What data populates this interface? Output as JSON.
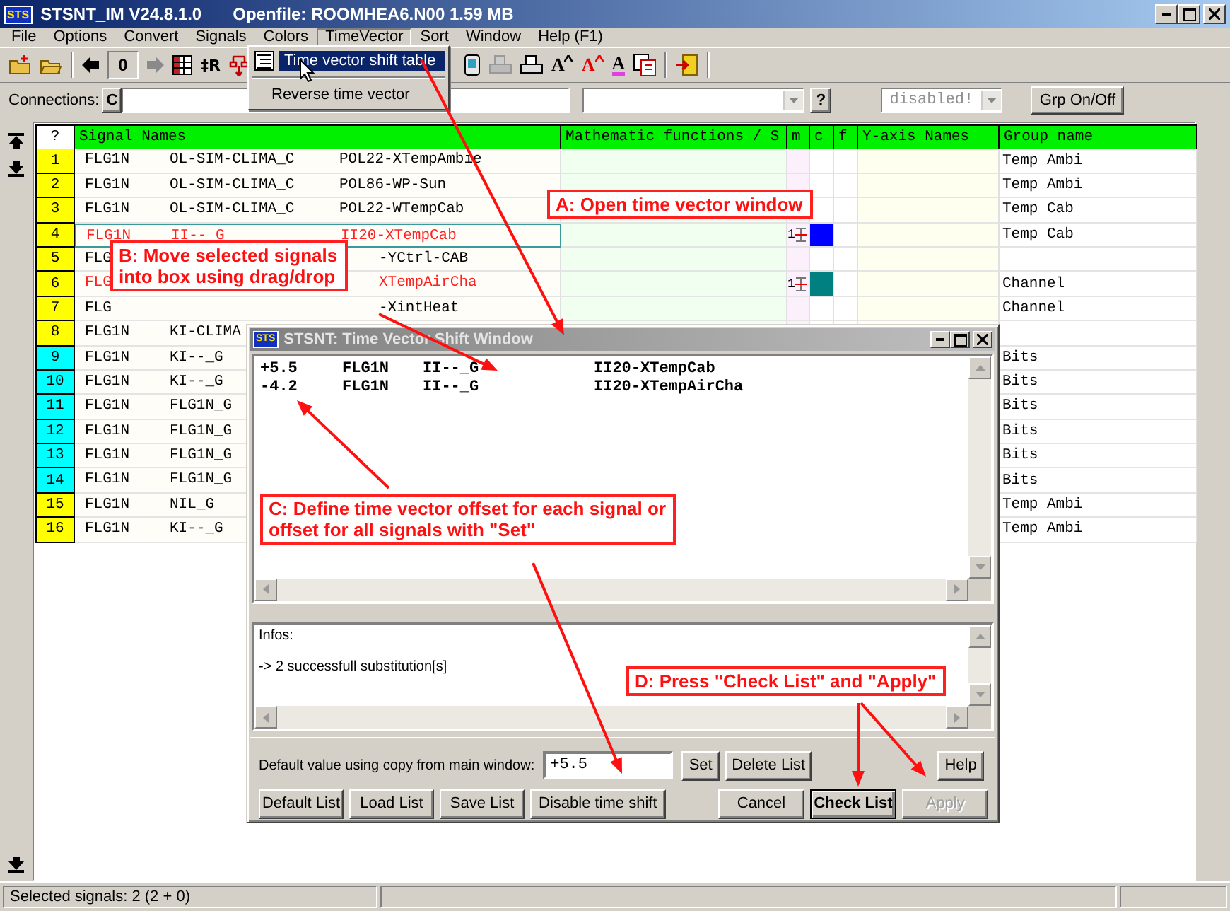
{
  "window": {
    "icon": "STS",
    "title": "STSNT_IM V24.8.1.0",
    "file": "Openfile: ROOMHEA6.N00  1.59 MB"
  },
  "menu": [
    {
      "label": "File",
      "selected": false
    },
    {
      "label": "Options",
      "selected": false
    },
    {
      "label": "Convert",
      "selected": false
    },
    {
      "label": "Signals",
      "selected": false
    },
    {
      "label": "Colors",
      "selected": false
    },
    {
      "label": "TimeVector",
      "selected": true
    },
    {
      "label": "Sort",
      "selected": false
    },
    {
      "label": "Window",
      "selected": false
    },
    {
      "label": "Help (F1)",
      "selected": false
    }
  ],
  "dropdown": [
    {
      "label": "Time vector shift table",
      "selected": true
    },
    {
      "label": "Reverse time vector",
      "selected": false
    }
  ],
  "toolbar": {
    "counter": "0",
    "glyphs": [
      {
        "kind": "plain",
        "text": "‡R"
      },
      {
        "kind": "grow",
        "text": "A"
      },
      {
        "kind": "grow-red",
        "text": "A"
      },
      {
        "kind": "colors",
        "text": "A"
      }
    ]
  },
  "connections": {
    "label": "Connections:",
    "button": "C",
    "help": "?",
    "state": "disabled!",
    "group_button": "Grp On/Off"
  },
  "table": {
    "columns": [
      "?",
      "Signal Names",
      "Mathematic functions / S",
      "m",
      "c",
      "f",
      "Y-axis Names",
      "Group name"
    ],
    "rows": [
      {
        "number": "1",
        "color": "#ffff00",
        "signal": {
          "col_1": "FLG1N",
          "col_2": "OL-SIM-CLIMA_C",
          "col_3": "POL22-XTempAmbie"
        },
        "selected": false,
        "focused": false,
        "group": "Temp Ambi"
      },
      {
        "number": "2",
        "color": "#ffff00",
        "signal": {
          "col_1": "FLG1N",
          "col_2": "OL-SIM-CLIMA_C",
          "col_3": "POL86-WP-Sun"
        },
        "selected": false,
        "focused": false,
        "group": "Temp Ambi"
      },
      {
        "number": "3",
        "color": "#ffff00",
        "signal": {
          "col_1": "FLG1N",
          "col_2": "OL-SIM-CLIMA_C",
          "col_3": "POL22-WTempCab"
        },
        "selected": false,
        "focused": false,
        "group": "Temp Cab"
      },
      {
        "number": "4",
        "color": "#ffff00",
        "signal": {
          "col_1": "FLG1N",
          "col_2": "II--_G",
          "col_3": "II20-XTempCab"
        },
        "selected": true,
        "focused": true,
        "m": "1",
        "curve": {
          "color": "#0000ff"
        },
        "group": "Temp Cab"
      },
      {
        "number": "5",
        "color": "#ffff00",
        "signal": {
          "col_1": "FLG",
          "col_3": "-YCtrl-CAB"
        },
        "selected": false,
        "focused": false
      },
      {
        "number": "6",
        "color": "#ffff00",
        "signal": {
          "col_1": "FLG",
          "col_3": "XTempAirCha"
        },
        "selected": true,
        "focused": false,
        "m": "1",
        "curve": {
          "color": "#008080"
        },
        "group": "Channel"
      },
      {
        "number": "7",
        "color": "#ffff00",
        "signal": {
          "col_1": "FLG",
          "col_3": "-XintHeat"
        },
        "selected": false,
        "focused": false,
        "group": "Channel"
      },
      {
        "number": "8",
        "color": "#ffff00",
        "signal": {
          "col_1": "FLG1N",
          "col_2": "KI-CLIMA"
        },
        "selected": false,
        "focused": false
      },
      {
        "number": "9",
        "color": "#00ffff",
        "signal": {
          "col_1": "FLG1N",
          "col_2": "KI--_G"
        },
        "selected": false,
        "focused": false,
        "group": "Bits"
      },
      {
        "number": "10",
        "color": "#00ffff",
        "signal": {
          "col_1": "FLG1N",
          "col_2": "KI--_G"
        },
        "selected": false,
        "focused": false,
        "group": "Bits"
      },
      {
        "number": "11",
        "color": "#00ffff",
        "signal": {
          "col_1": "FLG1N",
          "col_2": "FLG1N_G"
        },
        "selected": false,
        "focused": false,
        "group": "Bits"
      },
      {
        "number": "12",
        "color": "#00ffff",
        "signal": {
          "col_1": "FLG1N",
          "col_2": "FLG1N_G"
        },
        "selected": false,
        "focused": false,
        "group": "Bits"
      },
      {
        "number": "13",
        "color": "#00ffff",
        "signal": {
          "col_1": "FLG1N",
          "col_2": "FLG1N_G"
        },
        "selected": false,
        "focused": false,
        "group": "Bits"
      },
      {
        "number": "14",
        "color": "#00ffff",
        "signal": {
          "col_1": "FLG1N",
          "col_2": "FLG1N_G"
        },
        "selected": false,
        "focused": false,
        "group": "Bits"
      },
      {
        "number": "15",
        "color": "#ffff00",
        "signal": {
          "col_1": "FLG1N",
          "col_2": "NIL_G"
        },
        "selected": false,
        "focused": false,
        "group": "Temp Ambi"
      },
      {
        "number": "16",
        "color": "#ffff00",
        "signal": {
          "col_1": "FLG1N",
          "col_2": "KI--_G"
        },
        "selected": false,
        "focused": false,
        "group": "Temp Ambi"
      }
    ]
  },
  "dialog": {
    "icon": "STS",
    "title": "STSNT:  Time Vector Shift Window",
    "entries": [
      [
        "+5.5",
        "FLG1N",
        "II--_G",
        "II20-XTempCab"
      ],
      [
        "-4.2",
        "FLG1N",
        "II--_G",
        "II20-XTempAirCha"
      ]
    ],
    "info": [
      "Infos:",
      "-> 2 successfull substitution[s]"
    ],
    "default_label": "Default value using copy from main window:",
    "default_value": "+5.5",
    "buttons_top": [
      "Set",
      "Delete List"
    ],
    "help": "Help",
    "buttons_left": [
      "Default List",
      "Load List",
      "Save List",
      "Disable time shift"
    ],
    "buttons_right": [
      {
        "label": "Cancel",
        "default": false,
        "disabled": false
      },
      {
        "label": "Check List",
        "default": true,
        "disabled": false
      },
      {
        "label": "Apply",
        "default": false,
        "disabled": true
      }
    ]
  },
  "notes": [
    {
      "text": "A: Open time vector window"
    },
    {
      "text": "B: Move selected signals\ninto box using drag/drop"
    },
    {
      "text": "C: Define time vector offset for each signal or\noffset for all signals with \"Set\""
    },
    {
      "text": "D: Press \"Check List\" and \"Apply\""
    }
  ],
  "status_bar": "Selected signals: 2 (2 + 0)"
}
